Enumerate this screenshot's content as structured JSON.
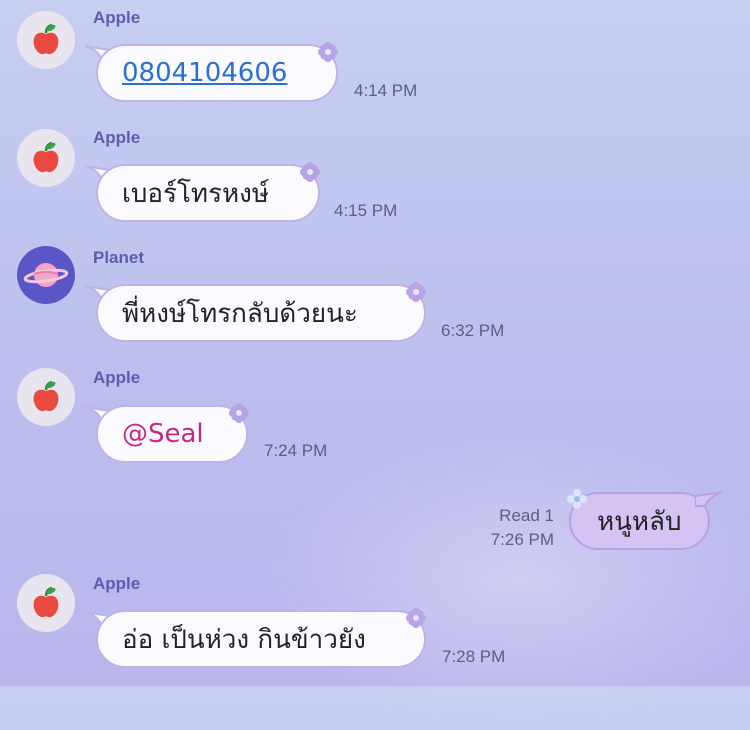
{
  "messages": [
    {
      "sender": "Apple",
      "text": "0804104606",
      "time": "4:14 PM"
    },
    {
      "sender": "Apple",
      "text": "เบอร์โทรหงษ์",
      "time": "4:15 PM"
    },
    {
      "sender": "Planet",
      "text": "พี่หงษ์โทรกลับด้วยนะ",
      "time": "6:32 PM"
    },
    {
      "sender": "Apple",
      "text": "@Seal",
      "time": "7:24 PM"
    },
    {
      "sender": "Apple",
      "text": "อ่อ เป็นห่วง กินข้าวยัง",
      "time": "7:28 PM"
    }
  ],
  "outgoing": {
    "text": "หนูหลับ",
    "read": "Read 1",
    "time": "7:26 PM"
  },
  "colors": {
    "link": "#2a6fd6",
    "mention": "#c4288a",
    "bubble_border": "#bcb3e6",
    "outgoing_bubble": "#d4c3f3"
  },
  "icons": {
    "apple_avatar": "apple-icon",
    "planet_avatar": "planet-icon",
    "bubble_decoration": "flower-icon"
  }
}
